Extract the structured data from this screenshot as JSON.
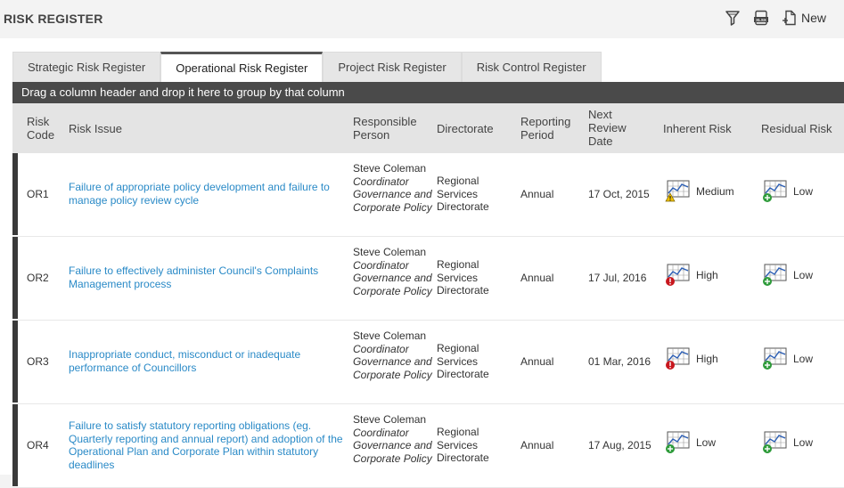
{
  "header": {
    "title": "RISK REGISTER",
    "new_label": "New"
  },
  "tabs": [
    {
      "label": "Strategic Risk Register"
    },
    {
      "label": "Operational Risk Register"
    },
    {
      "label": "Project Risk Register"
    },
    {
      "label": "Risk Control Register"
    }
  ],
  "group_bar": "Drag a column header and drop it here to group by that column",
  "columns": {
    "code_1": "Risk",
    "code_2": "Code",
    "issue": "Risk Issue",
    "person_1": "Responsible",
    "person_2": "Person",
    "directorate": "Directorate",
    "period_1": "Reporting",
    "period_2": "Period",
    "review_1": "Next",
    "review_2": "Review",
    "review_3": "Date",
    "inherent": "Inherent Risk",
    "residual": "Residual Risk"
  },
  "rows": [
    {
      "code": "OR1",
      "issue": "Failure of appropriate policy development and failure to manage policy review cycle",
      "person_name": "Steve Coleman",
      "person_role": "Coordinator Governance and Corporate Policy",
      "directorate": "Regional Services Directorate",
      "period": "Annual",
      "review": "17 Oct, 2015",
      "inherent": "Medium",
      "inherent_icon": "warning-icon",
      "residual": "Low",
      "residual_icon": "plus-icon"
    },
    {
      "code": "OR2",
      "issue": "Failure to effectively administer Council's Complaints Management process",
      "person_name": "Steve Coleman",
      "person_role": "Coordinator Governance and Corporate Policy",
      "directorate": "Regional Services Directorate",
      "period": "Annual",
      "review": "17 Jul, 2016",
      "inherent": "High",
      "inherent_icon": "alert-icon",
      "residual": "Low",
      "residual_icon": "plus-icon"
    },
    {
      "code": "OR3",
      "issue": "Inappropriate conduct, misconduct or inadequate performance of Councillors",
      "person_name": "Steve Coleman",
      "person_role": "Coordinator Governance and Corporate Policy",
      "directorate": "Regional Services Directorate",
      "period": "Annual",
      "review": "01 Mar, 2016",
      "inherent": "High",
      "inherent_icon": "alert-icon",
      "residual": "Low",
      "residual_icon": "plus-icon"
    },
    {
      "code": "OR4",
      "issue": "Failure to satisfy statutory reporting obligations (eg. Quarterly reporting and annual report) and adoption of the Operational Plan and Corporate Plan within statutory deadlines",
      "person_name": "Steve Coleman",
      "person_role": "Coordinator Governance and Corporate Policy",
      "directorate": "Regional Services Directorate",
      "period": "Annual",
      "review": "17 Aug, 2015",
      "inherent": "Low",
      "inherent_icon": "plus-icon",
      "residual": "Low",
      "residual_icon": "plus-icon"
    }
  ],
  "colors": {
    "link": "#2a8ac7",
    "group_bar": "#4a4a4a",
    "row_marker": "#3a3a3a"
  }
}
